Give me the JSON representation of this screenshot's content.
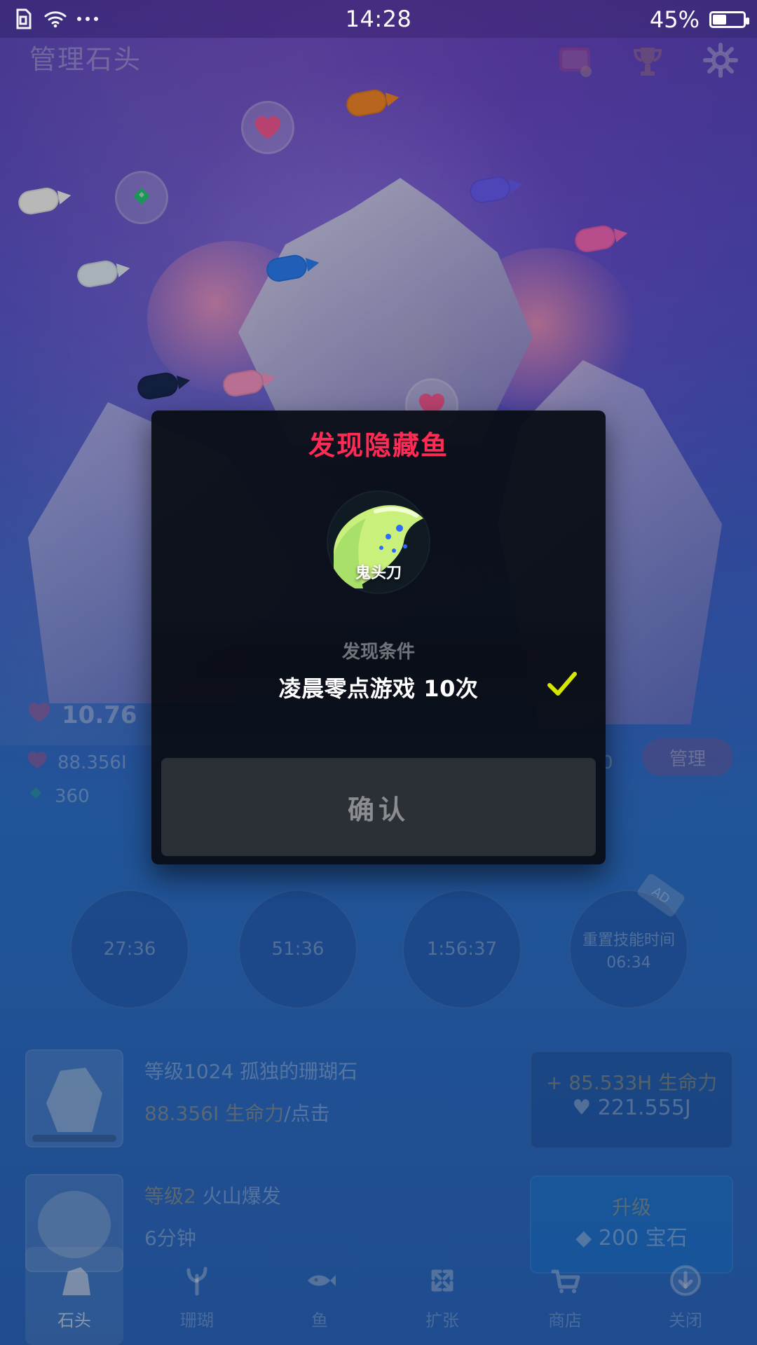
{
  "status_bar": {
    "time": "14:28",
    "battery_percent": "45%",
    "battery_level": 0.45
  },
  "header": {
    "title": "管理石头"
  },
  "stats": {
    "top_value": "10.76",
    "tap_value": "88.356I",
    "gem_value": "360",
    "mid_value": "0",
    "manage_label": "管理"
  },
  "timers": {
    "t1": "27:36",
    "t2": "51:36",
    "t3": "1:56:37",
    "skill_label": "重置技能时间",
    "skill_time": "06:34",
    "ad_label": "AD"
  },
  "list": {
    "rows": [
      {
        "title": "等级1024 孤独的珊瑚石",
        "sub_value": "88.356I 生命力",
        "sub_suffix": "/点击",
        "right_line1": "+ 85.533H 生命力",
        "right_line2": "221.555J"
      },
      {
        "title_prefix": "等级2",
        "title_suffix": "火山爆发",
        "sub_value": "6分钟",
        "right_line1": "升级",
        "right_line2": "200 宝石"
      }
    ]
  },
  "bottom_nav": {
    "items": [
      {
        "label": "石头",
        "active": true
      },
      {
        "label": "珊瑚",
        "active": false
      },
      {
        "label": "鱼",
        "active": false
      },
      {
        "label": "扩张",
        "active": false
      },
      {
        "label": "商店",
        "active": false
      },
      {
        "label": "关闭",
        "active": false
      }
    ]
  },
  "modal": {
    "title": "发现隐藏鱼",
    "fish_name": "鬼头刀",
    "condition_label": "发现条件",
    "condition_text": "凌晨零点游戏 10次",
    "confirm_label": "确认",
    "colors": {
      "title": "#ff2b54",
      "check": "#d6e600"
    }
  }
}
